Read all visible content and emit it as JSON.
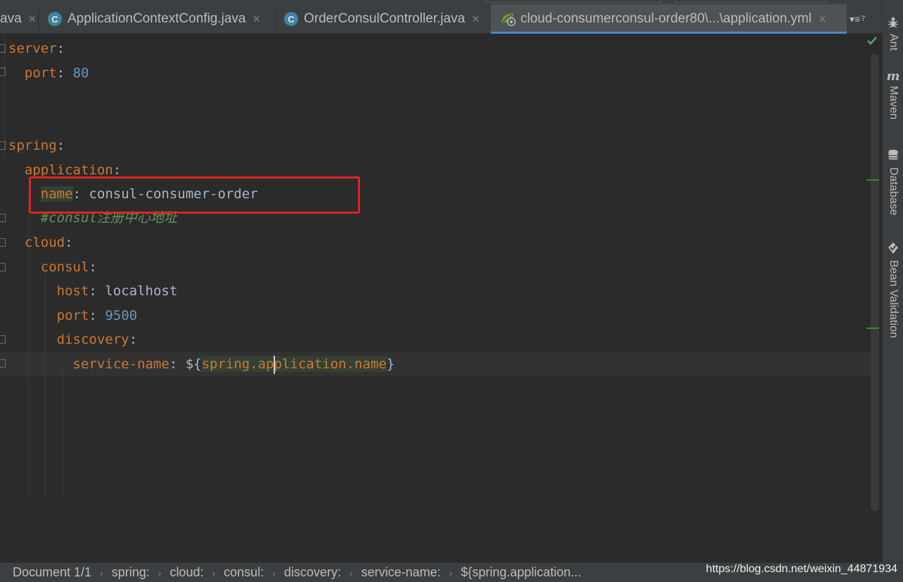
{
  "tabs": [
    {
      "label": "ava",
      "icon": "none",
      "active": false
    },
    {
      "label": "ApplicationContextConfig.java",
      "icon": "class-icon",
      "active": false
    },
    {
      "label": "OrderConsulController.java",
      "icon": "class-icon",
      "active": false
    },
    {
      "label": "cloud-consumerconsul-order80\\...\\application.yml",
      "icon": "spring-yaml-icon",
      "active": true
    }
  ],
  "tab_close_glyph": "×",
  "class_icon_letter": "C",
  "tab_overflow": {
    "glyph": "▾≡",
    "count": "7"
  },
  "tool_windows": [
    {
      "label": "Ant",
      "icon": "ant-icon"
    },
    {
      "label": "Maven",
      "icon": "maven-icon",
      "glyph": "m"
    },
    {
      "label": "Database",
      "icon": "database-icon"
    },
    {
      "label": "Bean Validation",
      "icon": "bean-validation-icon"
    }
  ],
  "code": {
    "l1_key": "server",
    "colon": ":",
    "l2_key": "port",
    "l2_val": "80",
    "l5_key": "spring",
    "l6_key": "application",
    "l7_key": "name",
    "l7_val": "consul-consumer-order",
    "l8_comment": "#consul注册中心地址",
    "l9_key": "cloud",
    "l10_key": "consul",
    "l11_key": "host",
    "l11_val": "localhost",
    "l12_key": "port",
    "l12_val": "9500",
    "l13_key": "discovery",
    "l14_key": "service-name",
    "l14_open": "${",
    "l14_ref_a": "spring.ap",
    "l14_ref_b": "plication.name",
    "l14_close": "}"
  },
  "colors": {
    "keyword": "#cc7832",
    "number": "#6897bb",
    "comment": "#629755",
    "annotation_box": "#e02424"
  },
  "breadcrumbs": [
    "Document 1/1",
    "spring:",
    "cloud:",
    "consul:",
    "discovery:",
    "service-name:",
    "${spring.application..."
  ],
  "watermark": "https://blog.csdn.net/weixin_44871934"
}
